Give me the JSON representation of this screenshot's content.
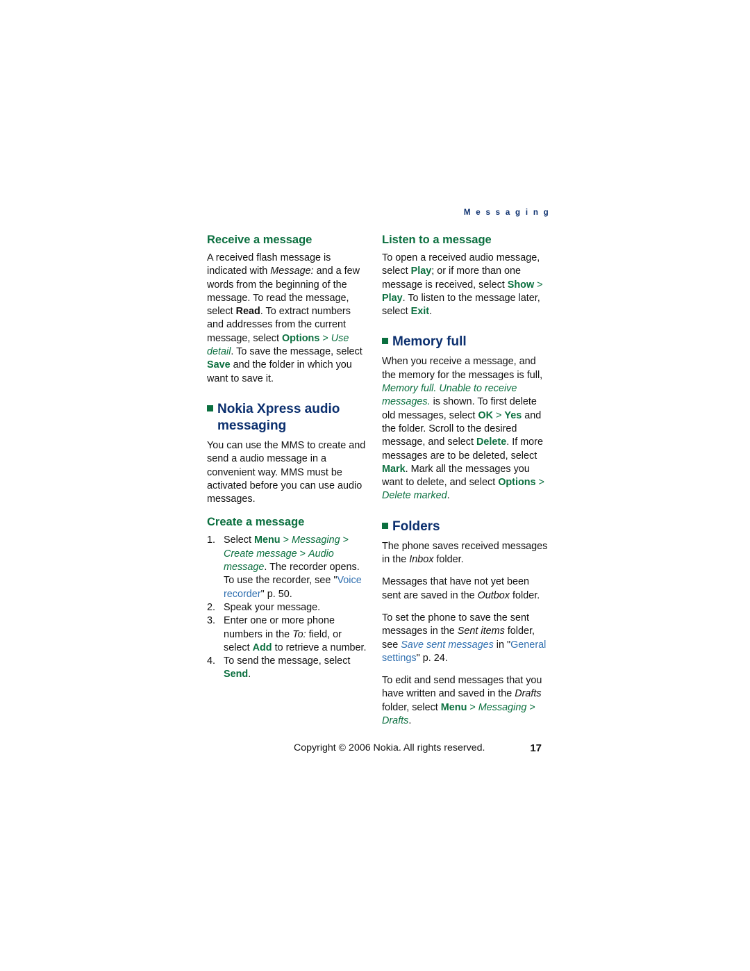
{
  "running_head": "M e s s a g i n g",
  "colors": {
    "heading_blue": "#0b2f6e",
    "heading_green": "#0b6f3f",
    "link_blue": "#2f6fb0",
    "body": "#111111"
  },
  "left_column": {
    "receive_heading": "Receive a message",
    "receive_p1_a": "A received flash message is indicated with ",
    "receive_p1_msg": "Message:",
    "receive_p1_b": " and a few words from the beginning of the message. To read the message, select ",
    "receive_p1_read": "Read",
    "receive_p1_c": ". To extract numbers and addresses from the current message, select ",
    "receive_p1_options": "Options",
    "receive_p1_gt1": " > ",
    "receive_p1_usedetail": "Use detail",
    "receive_p1_d": ". To save the message, select ",
    "receive_p1_save": "Save",
    "receive_p1_e": " and the folder in which you want to save it.",
    "xpress_heading_line1": "Nokia Xpress audio",
    "xpress_heading_line2": "messaging",
    "xpress_p1": "You can use the MMS to create and send a audio message in a convenient way. MMS must be activated before you can use audio messages.",
    "create_heading": "Create a message",
    "steps": [
      {
        "a": "Select ",
        "menu": "Menu",
        "gt1": " > ",
        "messaging": "Messaging",
        "gt2": " > ",
        "createmessage": "Create message",
        "gt3": " > ",
        "audio": "Audio message",
        "b": ". The recorder opens. To use the recorder, see \"",
        "link": "Voice recorder",
        "c": "\" p. ",
        "pagenum": "50",
        "d": "."
      },
      {
        "text": "Speak your message."
      },
      {
        "a": "Enter one or more phone numbers in the ",
        "to": "To:",
        "b": " field, or select ",
        "add": "Add",
        "c": " to retrieve a number."
      },
      {
        "a": "To send the message, select ",
        "send": "Send",
        "b": "."
      }
    ]
  },
  "right_column": {
    "listen_heading": "Listen to a message",
    "listen_p1_a": "To open a received audio message, select ",
    "listen_p1_play1": "Play",
    "listen_p1_b": "; or if more than one message is received, select ",
    "listen_p1_show": "Show",
    "listen_p1_gt": " > ",
    "listen_p1_play2": "Play",
    "listen_p1_c": ". To listen to the message later, select ",
    "listen_p1_exit": "Exit",
    "listen_p1_d": ".",
    "memory_heading": "Memory full",
    "memory_p1_a": "When you receive a message, and the memory for the messages is full, ",
    "memory_p1_italic": "Memory full. Unable to receive messages.",
    "memory_p1_b": " is shown. To first delete old messages, select ",
    "memory_p1_ok": "OK",
    "memory_p1_gt1": " > ",
    "memory_p1_yes": "Yes",
    "memory_p1_c": " and the folder. Scroll to the desired message, and select ",
    "memory_p1_delete": "Delete",
    "memory_p1_d": ". If more messages are to be deleted, select ",
    "memory_p1_mark": "Mark",
    "memory_p1_e": ". Mark all the messages you want to delete, and select ",
    "memory_p1_options": "Options",
    "memory_p1_gt2": " > ",
    "memory_p1_deletemarked": "Delete marked",
    "memory_p1_f": ".",
    "folders_heading": "Folders",
    "folders_p1_a": "The phone saves received messages in the ",
    "folders_p1_inbox": "Inbox",
    "folders_p1_b": " folder.",
    "folders_p2_a": "Messages that have not yet been sent are saved in the ",
    "folders_p2_outbox": "Outbox",
    "folders_p2_b": " folder.",
    "folders_p3_a": "To set the phone to save the sent messages in the ",
    "folders_p3_sentitems": "Sent items",
    "folders_p3_b": " folder, see ",
    "folders_p3_savesent": "Save sent messages",
    "folders_p3_c": " in \"",
    "folders_p3_general": "General settings",
    "folders_p3_d": "\" p. ",
    "folders_p3_pagenum": "24",
    "folders_p3_e": ".",
    "folders_p4_a": "To edit and send messages that you have written and saved in the ",
    "folders_p4_drafts1": "Drafts",
    "folders_p4_b": " folder, select ",
    "folders_p4_menu": "Menu",
    "folders_p4_gt1": " > ",
    "folders_p4_messaging": "Messaging",
    "folders_p4_gt2": " > ",
    "folders_p4_drafts2": "Drafts",
    "folders_p4_c": "."
  },
  "footer": {
    "copyright": "Copyright © 2006 Nokia. All rights reserved.",
    "page_number": "17"
  }
}
